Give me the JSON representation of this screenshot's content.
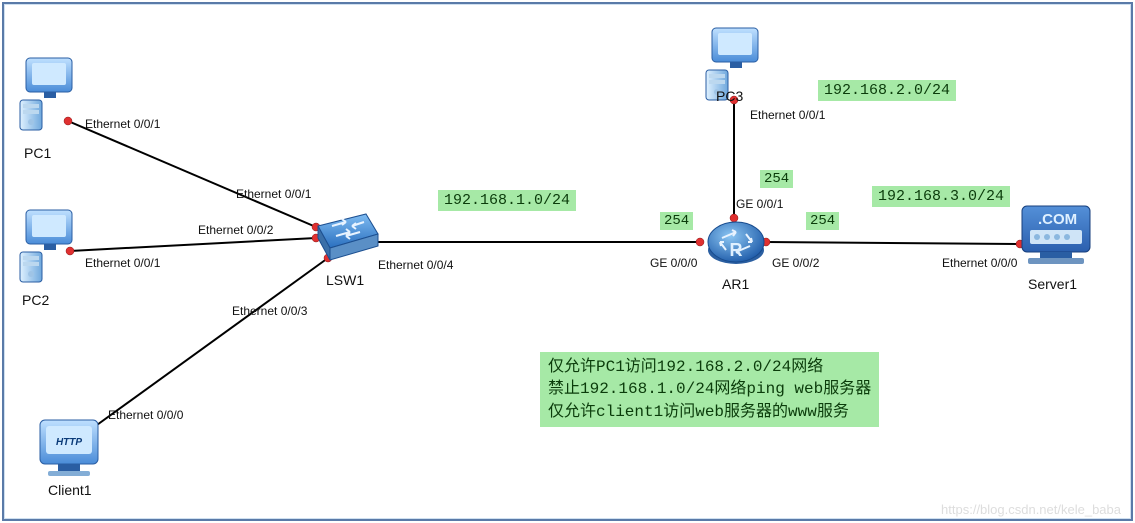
{
  "nodes": {
    "pc1": {
      "label": "PC1",
      "port": "Ethernet 0/0/1"
    },
    "pc2": {
      "label": "PC2",
      "port": "Ethernet 0/0/1"
    },
    "client1": {
      "label": "Client1",
      "port": "Ethernet 0/0/0"
    },
    "pc3": {
      "label": "PC3",
      "port": "Ethernet 0/0/1"
    },
    "server1": {
      "label": "Server1",
      "port": "Ethernet 0/0/0"
    },
    "lsw1": {
      "label": "LSW1",
      "ports": {
        "p1": "Ethernet 0/0/1",
        "p2": "Ethernet 0/0/2",
        "p3": "Ethernet 0/0/3",
        "p4": "Ethernet 0/0/4"
      }
    },
    "ar1": {
      "label": "AR1",
      "ports": {
        "g0": "GE 0/0/0",
        "g1": "GE 0/0/1",
        "g2": "GE 0/0/2"
      },
      "addrs": {
        "g0": "254",
        "g1": "254",
        "g2": "254"
      }
    }
  },
  "networks": {
    "lan1": "192.168.1.0/24",
    "lan2": "192.168.2.0/24",
    "lan3": "192.168.3.0/24"
  },
  "notes": "仅允许PC1访问192.168.2.0/24网络\n禁止192.168.1.0/24网络ping web服务器\n仅允许client1访问web服务器的www服务",
  "watermark": "https://blog.csdn.net/kele_baba"
}
